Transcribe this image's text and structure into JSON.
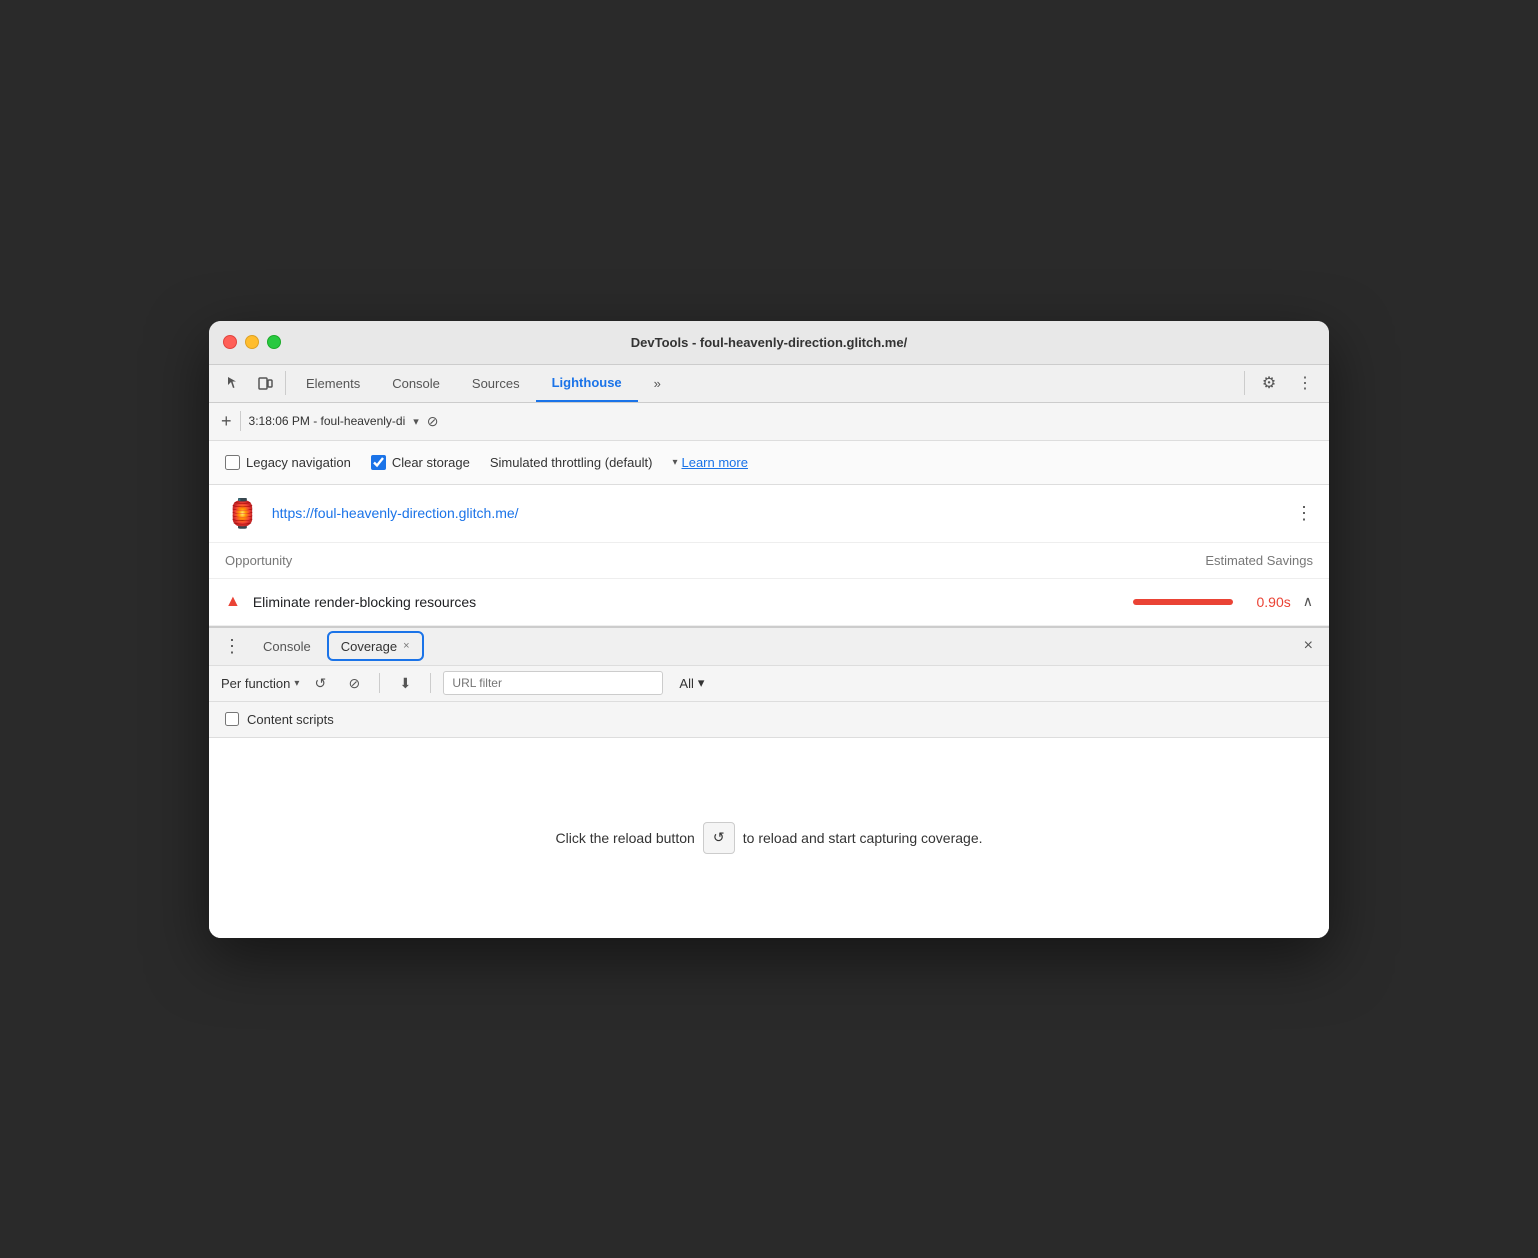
{
  "window": {
    "title": "DevTools - foul-heavenly-direction.glitch.me/"
  },
  "tabs": {
    "elements": "Elements",
    "console": "Console",
    "sources": "Sources",
    "lighthouse": "Lighthouse",
    "more": "»"
  },
  "url_bar": {
    "time": "3:18:06 PM - foul-heavenly-di",
    "add_label": "+"
  },
  "options": {
    "legacy_navigation": "Legacy navigation",
    "clear_storage": "Clear storage",
    "throttling": "Simulated throttling (default)",
    "learn_more": "Learn more"
  },
  "lighthouse": {
    "url": "https://foul-heavenly-direction.glitch.me/",
    "opportunity_label": "Opportunity",
    "savings_label": "Estimated Savings",
    "items": [
      {
        "title": "Eliminate render-blocking resources",
        "savings": "0.90s"
      }
    ]
  },
  "coverage": {
    "tab_label": "Coverage",
    "console_tab": "Console",
    "per_function": "Per function",
    "url_filter_placeholder": "URL filter",
    "all_dropdown": "All",
    "content_scripts": "Content scripts",
    "reload_message_before": "Click the reload button",
    "reload_message_after": "to reload and start capturing coverage."
  },
  "icons": {
    "close": "×",
    "chevron_up": "∧",
    "more_vert": "⋮",
    "block": "⊘",
    "download": "⬇",
    "reload": "↺",
    "dropdown": "▾",
    "dots": "⋮"
  }
}
